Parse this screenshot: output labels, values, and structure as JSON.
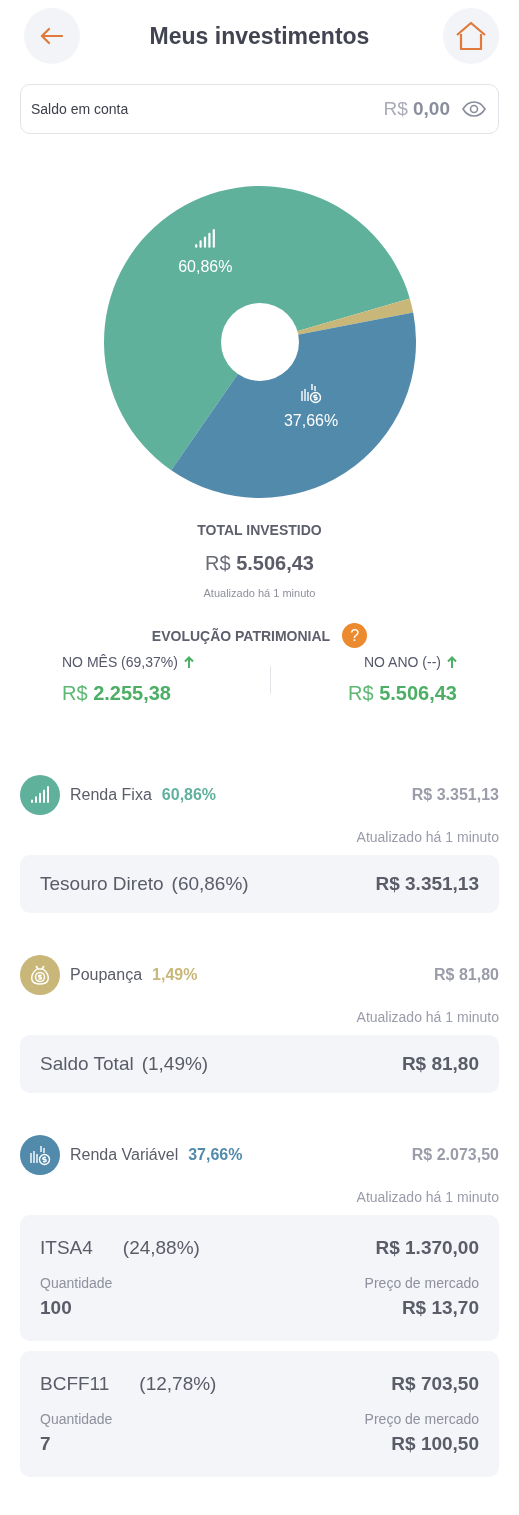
{
  "header": {
    "title": "Meus investimentos"
  },
  "balance": {
    "label": "Saldo em conta",
    "amount": "R$ **0,00**"
  },
  "allocation": {
    "chart_data": {
      "type": "donut",
      "values": [
        60.86,
        1.49,
        37.66
      ],
      "colors": [
        "#5fb19c",
        "#c9b779",
        "#528aab"
      ],
      "value_labels": [
        "60,86%",
        null,
        "37,66%"
      ]
    }
  },
  "total": {
    "title": "TOTAL INVESTIDO",
    "amount": "R$ **5.506,43**",
    "updated": "Atualizado há 1 minuto"
  },
  "evolution": {
    "title": "EVOLUÇÃO PATRIMONIAL",
    "help": "?",
    "periods": [
      {
        "label": "NO MÊS (69,37%)",
        "amount": "R$ **2.255,38**"
      },
      {
        "label": "NO ANO (--)",
        "amount": "R$ **5.506,43**"
      }
    ]
  },
  "categories": [
    {
      "color": "#5fb19c",
      "name": "Renda Fixa",
      "percent": "60,86%",
      "amount": "R$ 3.351,13",
      "updated": "Atualizado há 1 minuto",
      "holdings": [
        {
          "kind": "simple",
          "name": "Tesouro Direto",
          "percent": "(60,86%)",
          "amount": "R$ 3.351,13"
        }
      ]
    },
    {
      "color": "#c9b779",
      "name": "Poupança",
      "percent": "1,49%",
      "amount": "R$ 81,80",
      "updated": "Atualizado há 1 minuto",
      "holdings": [
        {
          "kind": "simple",
          "name": "Saldo Total",
          "percent": "(1,49%)",
          "amount": "R$ 81,80"
        }
      ]
    },
    {
      "color": "#528aab",
      "name": "Renda Variável",
      "percent": "37,66%",
      "amount": "R$ 2.073,50",
      "updated": "Atualizado há 1 minuto",
      "holdings": [
        {
          "kind": "stock",
          "name": "ITSA4",
          "percent": "(24,88%)",
          "amount": "R$ 1.370,00",
          "quantity_label": "Quantidade",
          "quantity": "100",
          "price_label": "Preço de mercado",
          "price": "R$ 13,70"
        },
        {
          "kind": "stock",
          "name": "BCFF11",
          "percent": "(12,78%)",
          "amount": "R$ 703,50",
          "quantity_label": "Quantidade",
          "quantity": "7",
          "price_label": "Preço de mercado",
          "price": "R$ 100,50"
        }
      ]
    }
  ]
}
